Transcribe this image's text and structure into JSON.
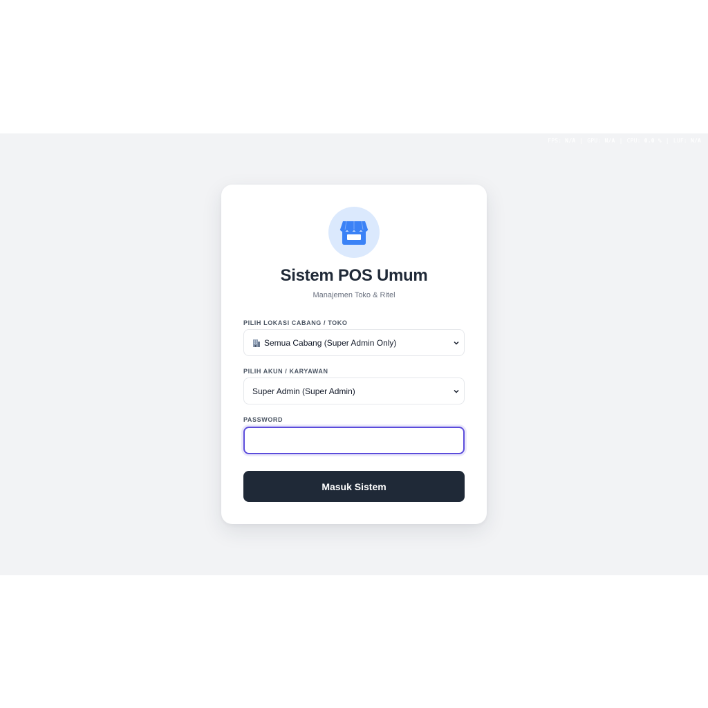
{
  "perf_overlay": {
    "fps_label": "FPS:",
    "fps_value": "N/A",
    "gpu_label": "GPU:",
    "gpu_value": "N/A",
    "cpu_label": "CPU:",
    "cpu_value": "0.0 %",
    "luf_label": "LUF:",
    "luf_value": "N/A"
  },
  "header": {
    "logo_icon": "storefront-icon",
    "title": "Sistem POS Umum",
    "subtitle": "Manajemen Toko & Ritel"
  },
  "branch": {
    "label": "PILIH LOKASI CABANG / TOKO",
    "icon": "office-building-icon",
    "selected": "Semua Cabang (Super Admin Only)"
  },
  "account": {
    "label": "PILIH AKUN / KARYAWAN",
    "selected": "Super Admin (Super Admin)"
  },
  "password": {
    "label": "PASSWORD",
    "value": "",
    "placeholder": ""
  },
  "submit": {
    "label": "Masuk Sistem"
  },
  "colors": {
    "background": "#f2f3f5",
    "card": "#ffffff",
    "primary_dark": "#1f2937",
    "focus_ring": "#5b4cdb",
    "logo_bg": "#dbe9fd",
    "logo_fg": "#3b82f6"
  }
}
